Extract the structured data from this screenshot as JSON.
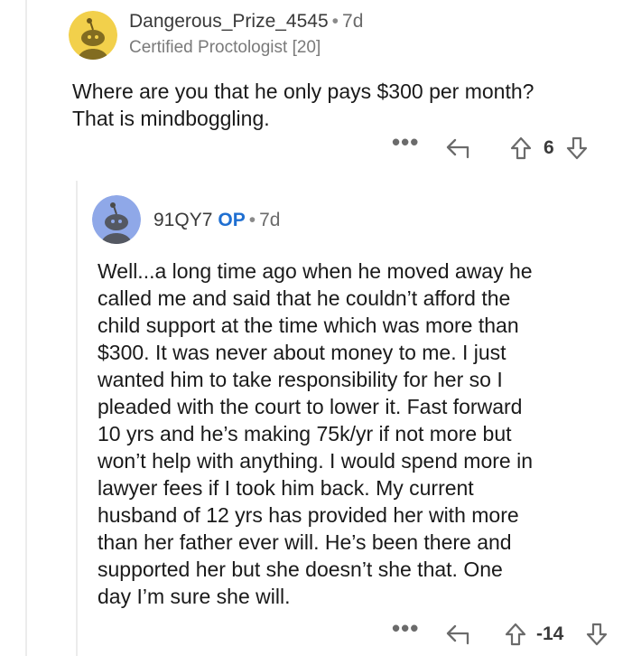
{
  "comment1": {
    "username": "Dangerous_Prize_4545",
    "separator": "•",
    "age": "7d",
    "flair": "Certified Proctologist [20]",
    "text": "Where are you that he only pays $300 per month?\nThat is mindboggling.",
    "more_label": "•••",
    "score": "6",
    "avatar_color": "#f2d04b"
  },
  "comment2": {
    "username": "91QY7",
    "op_badge": "OP",
    "separator": "•",
    "age": "7d",
    "text": "Well...a long time ago when he moved away he\ncalled me and said that he couldn’t afford the\nchild support at the time which was more than\n$300.  It was never about money to me.  I just\nwanted him to take responsibility for her so I\npleaded with the court to lower it.  Fast forward\n10 yrs and he’s making 75k/yr if not more but\nwon’t help with anything.  I would spend more in\nlawyer fees if I took him back. My current\nhusband of 12 yrs has provided her with more\nthan her father ever will.  He’s been there and\nsupported her but she doesn’t she that.  One\nday I’m sure she will.",
    "more_label": "•••",
    "score": "-14",
    "avatar_color": "#8fa8e8"
  },
  "colors": {
    "op_blue": "#1f6fd1",
    "icon_gray": "#6b6b6b",
    "thread_line": "#ececec"
  }
}
